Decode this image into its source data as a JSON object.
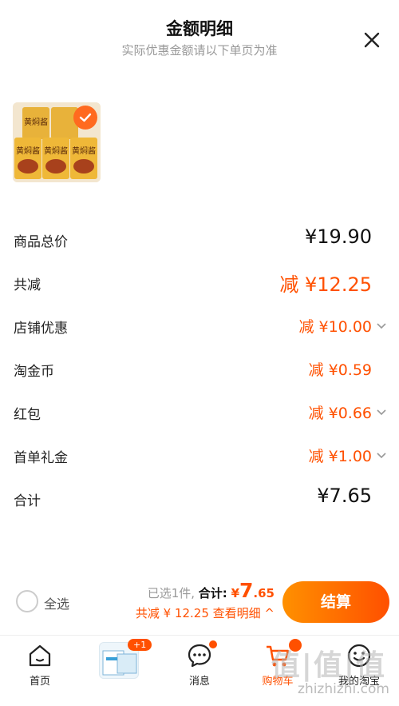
{
  "header": {
    "title": "金额明细",
    "subtitle": "实际优惠金额请以下单页为准"
  },
  "product": {
    "label": "黄焖酱"
  },
  "rows": [
    {
      "label": "商品总价",
      "value": "¥19.90"
    },
    {
      "label": "共减",
      "value": "减 ¥12.25"
    },
    {
      "label": "店铺优惠",
      "value": "减 ¥10.00"
    },
    {
      "label": "淘金币",
      "value": "减 ¥0.59"
    },
    {
      "label": "红包",
      "value": "减 ¥0.66"
    },
    {
      "label": "首单礼金",
      "value": "减 ¥1.00"
    },
    {
      "label": "合计",
      "value": "¥7.65"
    }
  ],
  "bottom": {
    "select_all": "全选",
    "selected": "已选1件,",
    "total_label": "合计:",
    "currency": "¥",
    "total_int": "7",
    "total_dec": ".65",
    "discount": "共减 ¥ 12.25",
    "details": "查看明细 ^",
    "checkout": "结算"
  },
  "tabs": [
    {
      "label": "首页"
    },
    {
      "label": "消息"
    },
    {
      "label": "购物车"
    },
    {
      "label": "我的淘宝"
    }
  ],
  "promo_badge": "+1",
  "watermark": {
    "text": "值|值|值",
    "url": "zhizhizhi.com"
  },
  "colors": {
    "accent": "#ff5000",
    "accent_light": "#ff9000"
  }
}
